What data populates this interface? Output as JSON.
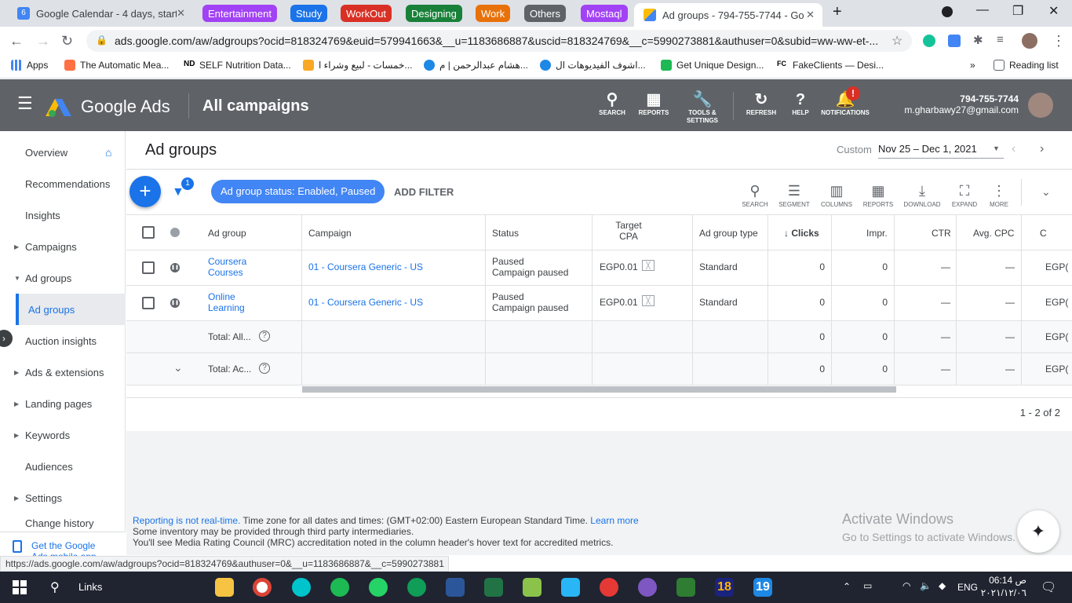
{
  "browser": {
    "tabs": [
      {
        "title": "Google Calendar - 4 days, startin",
        "favicon_color": "#4285f4"
      },
      {
        "title": "Ad groups - 794-755-7744 - Goo",
        "favicon_color": "#fbbc04"
      }
    ],
    "tab_groups": [
      {
        "label": "Entertainment",
        "color": "#a142f4"
      },
      {
        "label": "Study",
        "color": "#1a73e8"
      },
      {
        "label": "WorkOut",
        "color": "#d93025"
      },
      {
        "label": "Designing",
        "color": "#188038"
      },
      {
        "label": "Work",
        "color": "#e8710a"
      },
      {
        "label": "Others",
        "color": "#5f6368"
      },
      {
        "label": "Mostaql",
        "color": "#a142f4"
      }
    ],
    "url": "ads.google.com/aw/adgroups?ocid=818324769&euid=579941663&__u=1183686887&uscid=818324769&__c=5990273881&authuser=0&subid=ww-ww-et-...",
    "bookmarks": [
      "Apps",
      "The Automatic Mea...",
      "SELF Nutrition Data...",
      "خمسات - لبيع وشراء ا...",
      "هشام عبدالرحمن | م...",
      "اشوف الفيديوهات ال...",
      "Get Unique Design...",
      "FakeClients — Desi..."
    ],
    "reading_list": "Reading list",
    "status_url": "https://ads.google.com/aw/adgroups?ocid=818324769&authuser=0&__u=1183686887&__c=5990273881"
  },
  "header": {
    "product": "Google Ads",
    "section": "All campaigns",
    "icons": [
      {
        "label": "SEARCH",
        "icon": "search-icon"
      },
      {
        "label": "REPORTS",
        "icon": "reports-icon"
      },
      {
        "label": "TOOLS & SETTINGS",
        "icon": "wrench-icon"
      },
      {
        "label": "REFRESH",
        "icon": "refresh-icon"
      },
      {
        "label": "HELP",
        "icon": "help-icon"
      },
      {
        "label": "NOTIFICATIONS",
        "icon": "bell-icon"
      }
    ],
    "account_id": "794-755-7744",
    "email": "m.gharbawy27@gmail.com"
  },
  "sidebar": {
    "items": [
      {
        "label": "Overview"
      },
      {
        "label": "Recommendations"
      },
      {
        "label": "Insights"
      },
      {
        "label": "Campaigns"
      },
      {
        "label": "Ad groups"
      },
      {
        "label": "Ad groups"
      },
      {
        "label": "Auction insights"
      },
      {
        "label": "Ads & extensions"
      },
      {
        "label": "Landing pages"
      },
      {
        "label": "Keywords"
      },
      {
        "label": "Audiences"
      },
      {
        "label": "Settings"
      },
      {
        "label": "Change history"
      }
    ],
    "app_promo": "Get the Google Ads mobile app"
  },
  "page": {
    "title": "Ad groups",
    "date_label": "Custom",
    "date_range": "Nov 25 – Dec 1, 2021",
    "filter_badge": "1",
    "filter_chip": "Ad group status: Enabled, Paused",
    "add_filter": "ADD FILTER",
    "tools": [
      "SEARCH",
      "SEGMENT",
      "COLUMNS",
      "REPORTS",
      "DOWNLOAD",
      "EXPAND",
      "MORE"
    ],
    "pagination": "1 - 2 of 2"
  },
  "table": {
    "columns": [
      "Ad group",
      "Campaign",
      "Status",
      "Target CPA",
      "Ad group type",
      "Clicks",
      "Impr.",
      "CTR",
      "Avg. CPC",
      "C"
    ],
    "rows": [
      {
        "ad_group": "Coursera Courses",
        "campaign": "01 - Coursera Generic - US",
        "status1": "Paused",
        "status2": "Campaign paused",
        "cpa": "EGP0.01",
        "type": "Standard",
        "clicks": "0",
        "impr": "0",
        "ctr": "—",
        "cpc": "—",
        "cost": "EGP("
      },
      {
        "ad_group": "Online Learning",
        "campaign": "01 - Coursera Generic - US",
        "status1": "Paused",
        "status2": "Campaign paused",
        "cpa": "EGP0.01",
        "type": "Standard",
        "clicks": "0",
        "impr": "0",
        "ctr": "—",
        "cpc": "—",
        "cost": "EGP("
      }
    ],
    "totals": [
      {
        "label": "Total: All...",
        "clicks": "0",
        "impr": "0",
        "ctr": "—",
        "cpc": "—",
        "cost": "EGP("
      },
      {
        "label": "Total: Ac...",
        "clicks": "0",
        "impr": "0",
        "ctr": "—",
        "cpc": "—",
        "cost": "EGP("
      }
    ]
  },
  "footer": {
    "reporting_link": "Reporting is not real-time.",
    "timezone": "Time zone for all dates and times: (GMT+02:00) Eastern European Standard Time.",
    "learn_more": "Learn more",
    "line2": "Some inventory may be provided through third party intermediaries.",
    "line3": "You'll see Media Rating Council (MRC) accredited metrics.",
    "line3_full": "You'll see Media Rating Council (MRC) accreditation noted in the column header's hover text for accredited metrics."
  },
  "watermark": {
    "title": "Activate Windows",
    "subtitle": "Go to Settings to activate Windows."
  },
  "taskbar": {
    "search_label": "Links",
    "lang": "ENG",
    "time": "06:14 ص",
    "date": "٢٠٢١/١٢/٠٦"
  }
}
